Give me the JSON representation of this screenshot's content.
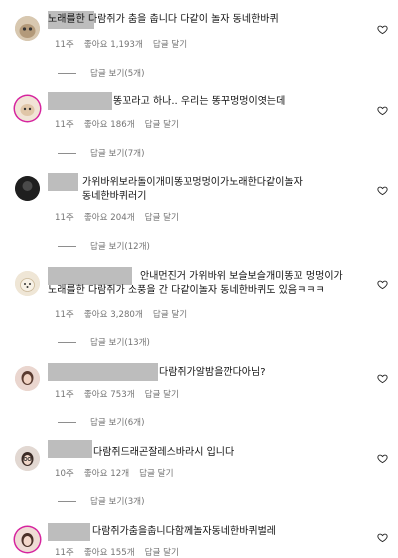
{
  "comments": [
    {
      "text": "노래를한 다람쥐가 춤을 춥니다 다같이 놀자 동네한바퀴",
      "time": "11주",
      "likes": "좋아요 1,193개",
      "reply_label": "답글 달기",
      "view_replies": "답글 보기(5개)",
      "avatar": "cat-avatar"
    },
    {
      "text": "똥꼬라고 하나.. 우리는 똥꾸멍멍이엿는데",
      "time": "11주",
      "likes": "좋아요 186개",
      "reply_label": "답글 달기",
      "view_replies": "답글 보기(7개)",
      "avatar": "story-ring-avatar"
    },
    {
      "text": "가위바위보라돌이개미똥꼬멍멍이가노래한다같이놀자\n동네한바퀴러기",
      "time": "11주",
      "likes": "좋아요 204개",
      "reply_label": "답글 달기",
      "view_replies": "답글 보기(12개)",
      "avatar": "dark-avatar"
    },
    {
      "text": "안내먼진거 가위바위 보슬보슬개미똥꼬 멍멍이가\n노래를한 다람쥐가 소풍을 간 다같이놀자 동네한바퀴도 있음ㅋㅋㅋ",
      "time": "11주",
      "likes": "좋아요 3,280개",
      "reply_label": "답글 달기",
      "view_replies": "답글 보기(13개)",
      "avatar": "dog-avatar"
    },
    {
      "text": "다람쥐가알밤을깐다아님?",
      "time": "11주",
      "likes": "좋아요 753개",
      "reply_label": "답글 달기",
      "view_replies": "답글 보기(6개)",
      "avatar": "person-avatar"
    },
    {
      "text": "다람쥐드래곤잘레스바라시 입니다",
      "time": "10주",
      "likes": "좋아요 12개",
      "reply_label": "답글 달기",
      "view_replies": "답글 보기(3개)",
      "avatar": "glasses-avatar"
    },
    {
      "text": "다람쥐가춤을춥니다함께놀자동네한바퀴벌레",
      "time": "11주",
      "likes": "좋아요 155개",
      "reply_label": "답글 달기",
      "view_replies": "",
      "avatar": "ring-person-avatar"
    }
  ],
  "colors": {
    "meta": "#737373",
    "redaction": "#bdbdbd",
    "story_ring": "#d6249f"
  }
}
